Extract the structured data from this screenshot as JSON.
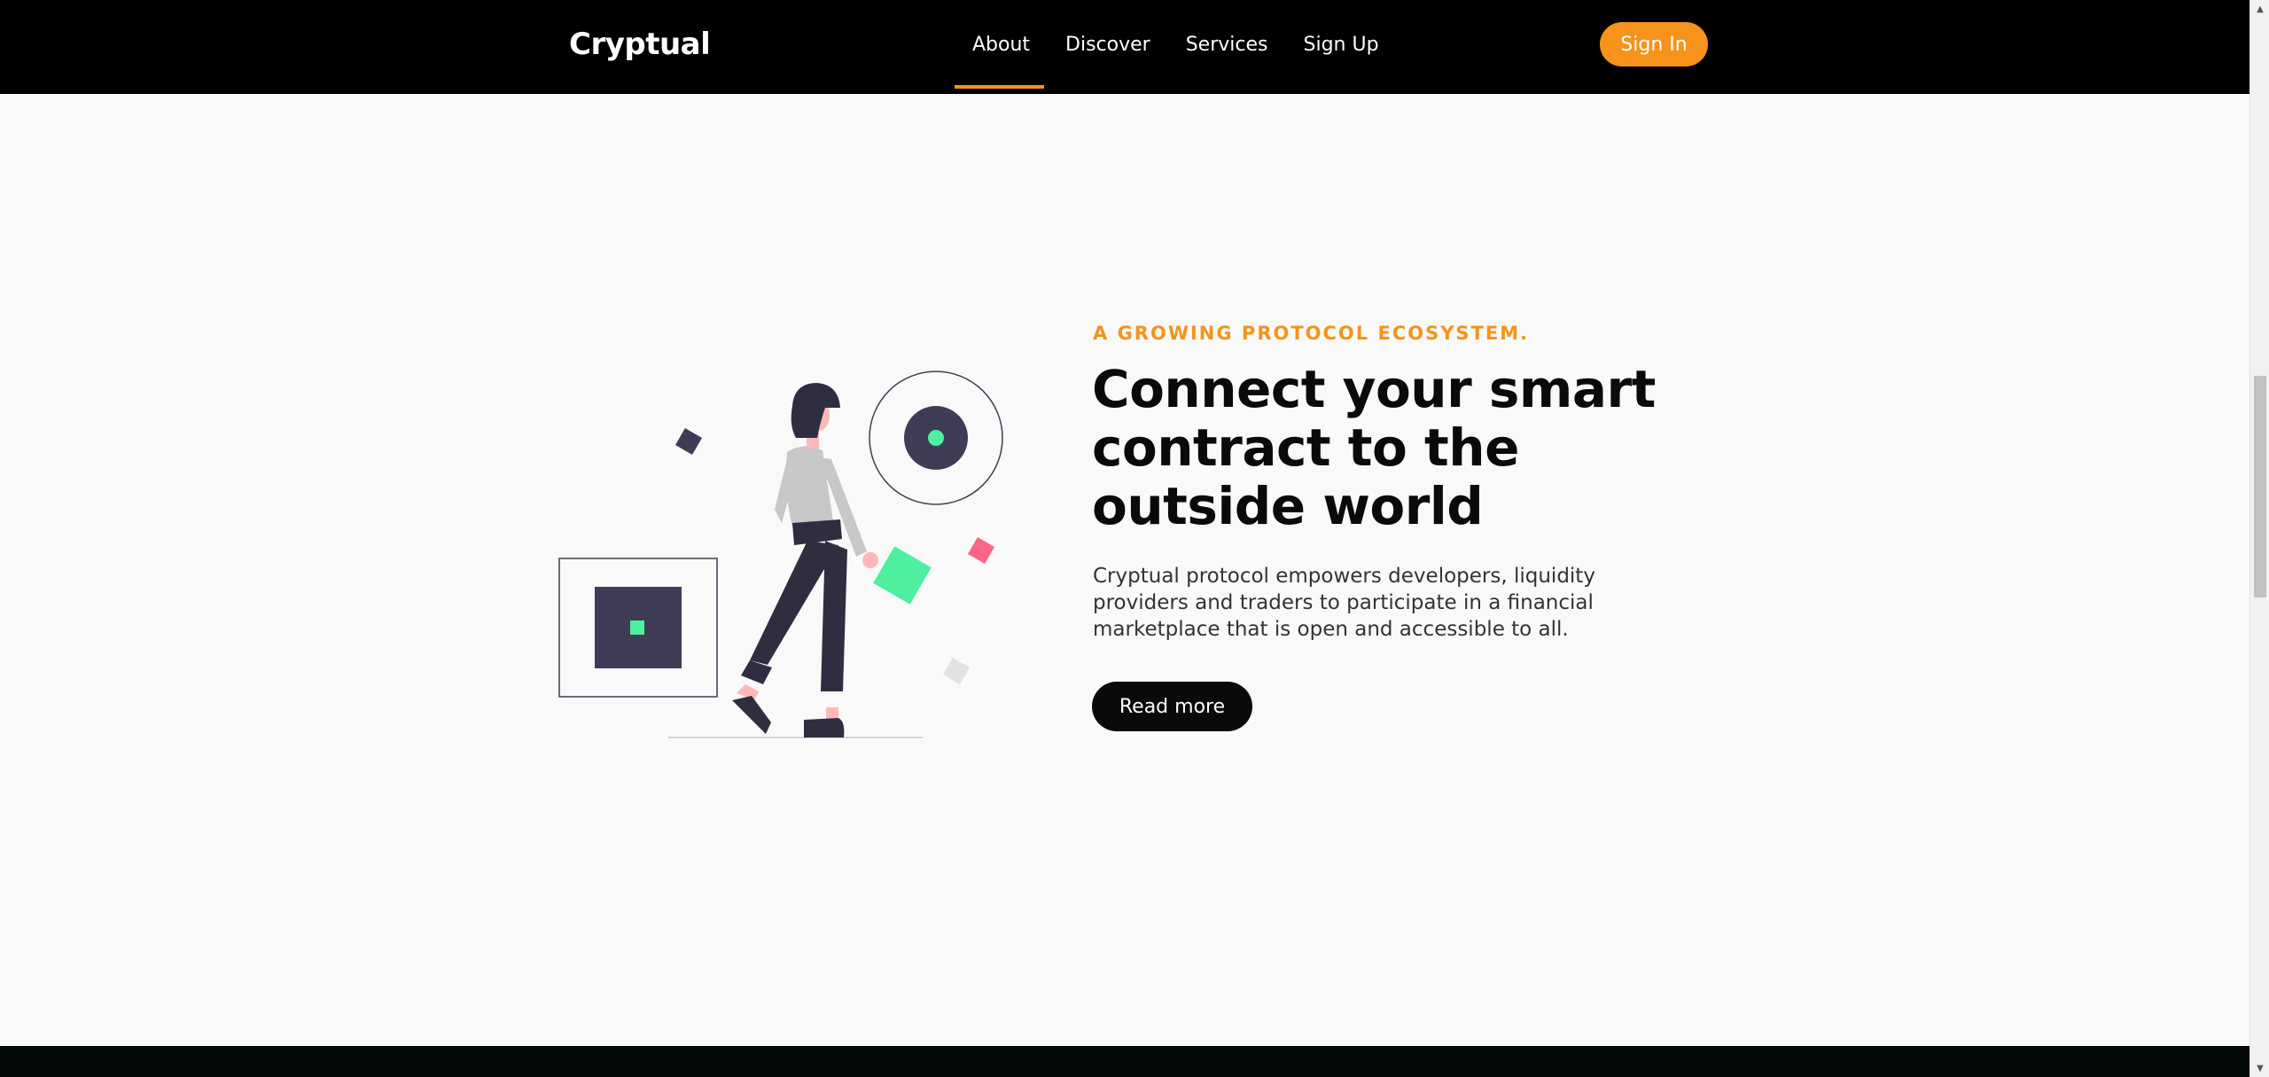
{
  "navbar": {
    "brand": "Cryptual",
    "links": [
      {
        "label": "About",
        "active": true
      },
      {
        "label": "Discover",
        "active": false
      },
      {
        "label": "Services",
        "active": false
      },
      {
        "label": "Sign Up",
        "active": false
      }
    ],
    "signin_label": "Sign In"
  },
  "hero": {
    "eyebrow": "A GROWING PROTOCOL ECOSYSTEM.",
    "headline": "Connect your smart contract to the outside world",
    "description": "Cryptual protocol empowers developers, liquidity providers and traders to participate in a financial marketplace that is open and accessible to all.",
    "cta_label": "Read more",
    "illustration_icon": "woman-walking-with-geometric-shapes-illustration"
  },
  "colors": {
    "accent": "#f7931a",
    "navbar_bg": "#000000",
    "page_bg": "#f9f9f9",
    "dark": "#0a0a0a",
    "shape_dark": "#3f3d56",
    "shape_green": "#4ef0a0",
    "shape_pink": "#ff6584"
  }
}
